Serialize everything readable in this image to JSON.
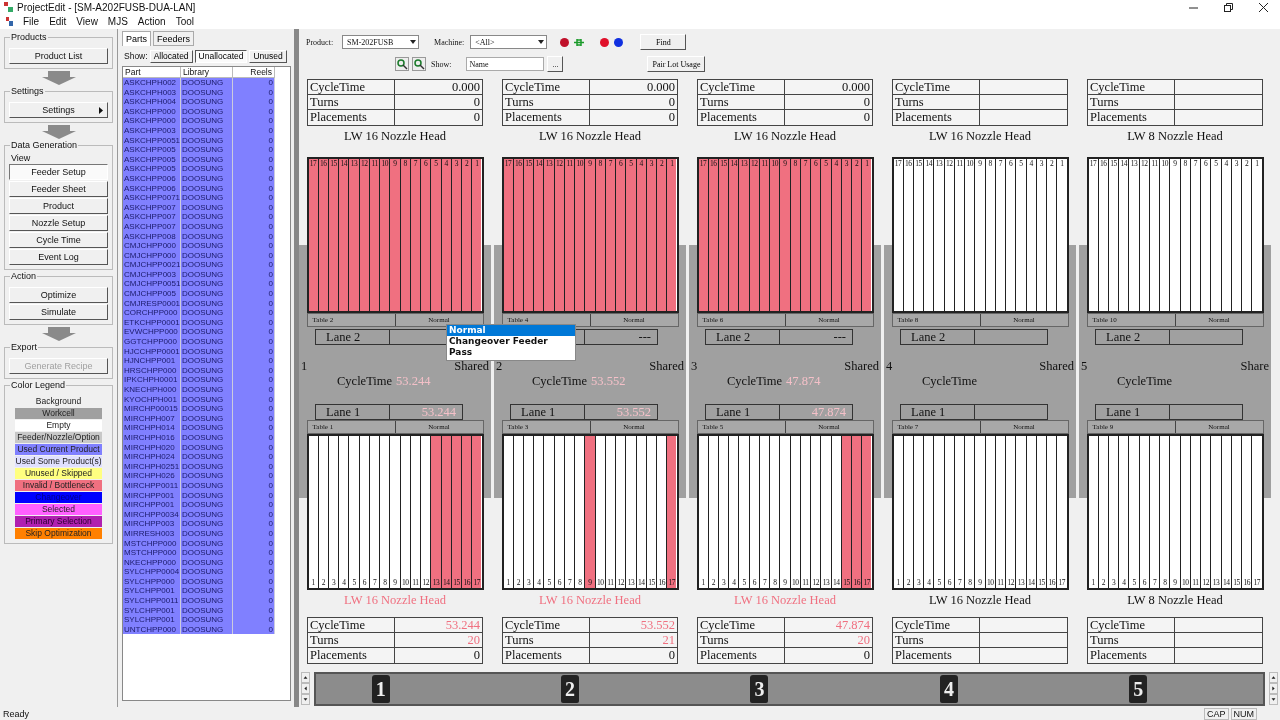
{
  "window": {
    "title": "ProjectEdit - [SM-A202FUSB-DUA-LAN]"
  },
  "menu": [
    "File",
    "Edit",
    "View",
    "MJS",
    "Action",
    "Tool"
  ],
  "sidebar": {
    "groups": [
      {
        "title": "Products",
        "arrow_after": true,
        "buttons": [
          {
            "label": "Product List",
            "kind": "plain",
            "selected": false,
            "disabled": false
          }
        ]
      },
      {
        "title": "Settings",
        "arrow_after": true,
        "buttons": [
          {
            "label": "Settings",
            "kind": "submenu",
            "selected": false,
            "disabled": false
          }
        ]
      },
      {
        "title": "Data Generation",
        "subtitle": "View",
        "arrow_after": false,
        "buttons": [
          {
            "label": "Feeder Setup",
            "kind": "plain",
            "selected": true,
            "disabled": false
          },
          {
            "label": "Feeder Sheet",
            "kind": "plain",
            "selected": false,
            "disabled": false
          },
          {
            "label": "Product",
            "kind": "plain",
            "selected": false,
            "disabled": false
          },
          {
            "label": "Nozzle Setup",
            "kind": "plain",
            "selected": false,
            "disabled": false
          },
          {
            "label": "Cycle Time",
            "kind": "plain",
            "selected": false,
            "disabled": false
          },
          {
            "label": "Event Log",
            "kind": "plain",
            "selected": false,
            "disabled": false
          }
        ]
      },
      {
        "title": "Action",
        "arrow_after": true,
        "buttons": [
          {
            "label": "Optimize",
            "kind": "plain",
            "selected": false,
            "disabled": false
          },
          {
            "label": "Simulate",
            "kind": "plain",
            "selected": false,
            "disabled": false
          }
        ]
      },
      {
        "title": "Export",
        "arrow_after": false,
        "buttons": [
          {
            "label": "Generate Recipe",
            "kind": "plain",
            "selected": false,
            "disabled": true
          }
        ]
      }
    ],
    "legend": {
      "title": "Color Legend",
      "items": [
        {
          "label": "Background",
          "color": "#f0f0f0"
        },
        {
          "label": "Workcell",
          "color": "#a0a0a0"
        },
        {
          "label": "Empty",
          "color": "#ffffff"
        },
        {
          "label": "Feeder/Nozzle/Option",
          "color": "#c8c8c8"
        },
        {
          "label": "Used Current Product",
          "color": "#8080ff"
        },
        {
          "label": "Used Some Product(s)",
          "color": "#e0e0ff"
        },
        {
          "label": "Unused / Skipped",
          "color": "#ffff80"
        },
        {
          "label": "Invalid / Bottleneck",
          "color": "#f07080"
        },
        {
          "label": "Changeover",
          "color": "#0000ff"
        },
        {
          "label": "Selected",
          "color": "#ff60ff"
        },
        {
          "label": "Primary Selection",
          "color": "#b020b0"
        },
        {
          "label": "Skip Optimization",
          "color": "#ff8000"
        }
      ]
    }
  },
  "parts": {
    "tabs": [
      {
        "label": "Parts",
        "selected": true
      },
      {
        "label": "Feeders",
        "selected": false
      }
    ],
    "show_label": "Show:",
    "filters": [
      {
        "label": "Allocated",
        "selected": false
      },
      {
        "label": "Unallocated",
        "selected": true
      },
      {
        "label": "Unused",
        "selected": false
      }
    ],
    "columns": [
      "Part",
      "Library",
      "Reels"
    ],
    "rows": [
      {
        "part": "ASKCHPH002",
        "library": "DOOSUNG",
        "reels": "0"
      },
      {
        "part": "ASKCHPH003",
        "library": "DOOSUNG",
        "reels": "0"
      },
      {
        "part": "ASKCHPH004",
        "library": "DOOSUNG",
        "reels": "0"
      },
      {
        "part": "ASKCHPP000",
        "library": "DOOSUNG",
        "reels": "0"
      },
      {
        "part": "ASKCHPP000",
        "library": "DOOSUNG",
        "reels": "0"
      },
      {
        "part": "ASKCHPP003",
        "library": "DOOSUNG",
        "reels": "0"
      },
      {
        "part": "ASKCHPP0051",
        "library": "DOOSUNG",
        "reels": "0"
      },
      {
        "part": "ASKCHPP005",
        "library": "DOOSUNG",
        "reels": "0"
      },
      {
        "part": "ASKCHPP005",
        "library": "DOOSUNG",
        "reels": "0"
      },
      {
        "part": "ASKCHPP005",
        "library": "DOOSUNG",
        "reels": "0"
      },
      {
        "part": "ASKCHPP006",
        "library": "DOOSUNG",
        "reels": "0"
      },
      {
        "part": "ASKCHPP006",
        "library": "DOOSUNG",
        "reels": "0"
      },
      {
        "part": "ASKCHPP0071",
        "library": "DOOSUNG",
        "reels": "0"
      },
      {
        "part": "ASKCHPP007",
        "library": "DOOSUNG",
        "reels": "0"
      },
      {
        "part": "ASKCHPP007",
        "library": "DOOSUNG",
        "reels": "0"
      },
      {
        "part": "ASKCHPP007",
        "library": "DOOSUNG",
        "reels": "0"
      },
      {
        "part": "ASKCHPP008",
        "library": "DOOSUNG",
        "reels": "0"
      },
      {
        "part": "CMJCHPP000",
        "library": "DOOSUNG",
        "reels": "0"
      },
      {
        "part": "CMJCHPP000",
        "library": "DOOSUNG",
        "reels": "0"
      },
      {
        "part": "CMJCHPP0021",
        "library": "DOOSUNG",
        "reels": "0"
      },
      {
        "part": "CMJCHPP003",
        "library": "DOOSUNG",
        "reels": "0"
      },
      {
        "part": "CMJCHPP0051",
        "library": "DOOSUNG",
        "reels": "0"
      },
      {
        "part": "CMJCHPP005",
        "library": "DOOSUNG",
        "reels": "0"
      },
      {
        "part": "CMJRESP0001",
        "library": "DOOSUNG",
        "reels": "0"
      },
      {
        "part": "CORCHPP000",
        "library": "DOOSUNG",
        "reels": "0"
      },
      {
        "part": "ETKCHPP0001",
        "library": "DOOSUNG",
        "reels": "0"
      },
      {
        "part": "EVWCHPP000",
        "library": "DOOSUNG",
        "reels": "0"
      },
      {
        "part": "GGTCHPP000",
        "library": "DOOSUNG",
        "reels": "0"
      },
      {
        "part": "HJCCHPP0001",
        "library": "DOOSUNG",
        "reels": "0"
      },
      {
        "part": "HJNCHPP001",
        "library": "DOOSUNG",
        "reels": "0"
      },
      {
        "part": "HRSCHPP000",
        "library": "DOOSUNG",
        "reels": "0"
      },
      {
        "part": "IPKCHPH0001",
        "library": "DOOSUNG",
        "reels": "0"
      },
      {
        "part": "KNECHPH000",
        "library": "DOOSUNG",
        "reels": "0"
      },
      {
        "part": "KYOCHPH001",
        "library": "DOOSUNG",
        "reels": "0"
      },
      {
        "part": "MIRCHP00015",
        "library": "DOOSUNG",
        "reels": "0"
      },
      {
        "part": "MIRCHPH007",
        "library": "DOOSUNG",
        "reels": "0"
      },
      {
        "part": "MIRCHPH014",
        "library": "DOOSUNG",
        "reels": "0"
      },
      {
        "part": "MIRCHPH016",
        "library": "DOOSUNG",
        "reels": "0"
      },
      {
        "part": "MIRCHPH020",
        "library": "DOOSUNG",
        "reels": "0"
      },
      {
        "part": "MIRCHPH024",
        "library": "DOOSUNG",
        "reels": "0"
      },
      {
        "part": "MIRCHPH0251",
        "library": "DOOSUNG",
        "reels": "0"
      },
      {
        "part": "MIRCHPH026",
        "library": "DOOSUNG",
        "reels": "0"
      },
      {
        "part": "MIRCHPP0011",
        "library": "DOOSUNG",
        "reels": "0"
      },
      {
        "part": "MIRCHPP001",
        "library": "DOOSUNG",
        "reels": "0"
      },
      {
        "part": "MIRCHPP001",
        "library": "DOOSUNG",
        "reels": "0"
      },
      {
        "part": "MIRCHPP0034",
        "library": "DOOSUNG",
        "reels": "0"
      },
      {
        "part": "MIRCHPP003",
        "library": "DOOSUNG",
        "reels": "0"
      },
      {
        "part": "MIRRESH003",
        "library": "DOOSUNG",
        "reels": "0"
      },
      {
        "part": "MSTCHPP000",
        "library": "DOOSUNG",
        "reels": "0"
      },
      {
        "part": "MSTCHPP000",
        "library": "DOOSUNG",
        "reels": "0"
      },
      {
        "part": "NKECHPP000",
        "library": "DOOSUNG",
        "reels": "0"
      },
      {
        "part": "SYLCHPP0004",
        "library": "DOOSUNG",
        "reels": "0"
      },
      {
        "part": "SYLCHPP000",
        "library": "DOOSUNG",
        "reels": "0"
      },
      {
        "part": "SYLCHPP001",
        "library": "DOOSUNG",
        "reels": "0"
      },
      {
        "part": "SYLCHPP0011",
        "library": "DOOSUNG",
        "reels": "0"
      },
      {
        "part": "SYLCHPP001",
        "library": "DOOSUNG",
        "reels": "0"
      },
      {
        "part": "SYLCHPP001",
        "library": "DOOSUNG",
        "reels": "0"
      },
      {
        "part": "UNTCHPP000",
        "library": "DOOSUNG",
        "reels": "0"
      }
    ]
  },
  "toolbar": {
    "product_label": "Product:",
    "product": "SM-202FUSB",
    "machine_label": "Machine:",
    "machine": "<All>",
    "find": "Find",
    "show_label": "Show:",
    "show": "Name",
    "browse": "...",
    "pair_lot": "Pair Lot Usage"
  },
  "popup_menu": {
    "items": [
      {
        "label": "Normal",
        "selected": true
      },
      {
        "label": "Changeover Feeder",
        "selected": false
      },
      {
        "label": "Pass",
        "selected": false
      }
    ]
  },
  "machines": [
    {
      "number": "1",
      "shared": "Shared",
      "top_stats": [
        {
          "label": "CycleTime",
          "value": "0.000"
        },
        {
          "label": "Turns",
          "value": "0"
        },
        {
          "label": "Placements",
          "value": "0"
        }
      ],
      "top_head": {
        "label": "LW 16 Nozzle Head",
        "invalid": false
      },
      "rear_table": {
        "name": "Table 2",
        "mode": "Normal",
        "slots": [
          {
            "n": "17",
            "used": true
          },
          {
            "n": "16",
            "used": true
          },
          {
            "n": "15",
            "used": true
          },
          {
            "n": "14",
            "used": true
          },
          {
            "n": "13",
            "used": true
          },
          {
            "n": "12",
            "used": true
          },
          {
            "n": "11",
            "used": true
          },
          {
            "n": "10",
            "used": true
          },
          {
            "n": "9",
            "used": true
          },
          {
            "n": "8",
            "used": true
          },
          {
            "n": "7",
            "used": true
          },
          {
            "n": "6",
            "used": true
          },
          {
            "n": "5",
            "used": true
          },
          {
            "n": "4",
            "used": true
          },
          {
            "n": "3",
            "used": true
          },
          {
            "n": "2",
            "used": true
          },
          {
            "n": "1",
            "used": true
          }
        ]
      },
      "rear_lane": {
        "label": "Lane 2"
      },
      "cycle": {
        "label": "CycleTime",
        "value": "53.244"
      },
      "front_lane": {
        "label": "Lane 1",
        "value": "53.244"
      },
      "front_table": {
        "name": "Table 1",
        "mode": "Normal",
        "slots": [
          {
            "n": "1",
            "used": false
          },
          {
            "n": "2",
            "used": false
          },
          {
            "n": "3",
            "used": false
          },
          {
            "n": "4",
            "used": false
          },
          {
            "n": "5",
            "used": false
          },
          {
            "n": "6",
            "used": false
          },
          {
            "n": "7",
            "used": false
          },
          {
            "n": "8",
            "used": false
          },
          {
            "n": "9",
            "used": false
          },
          {
            "n": "10",
            "used": false
          },
          {
            "n": "11",
            "used": false
          },
          {
            "n": "12",
            "used": false
          },
          {
            "n": "13",
            "used": true
          },
          {
            "n": "14",
            "used": true
          },
          {
            "n": "15",
            "used": true
          },
          {
            "n": "16",
            "used": true
          },
          {
            "n": "17",
            "used": true
          }
        ]
      },
      "bottom_head": {
        "label": "LW 16 Nozzle Head",
        "invalid": true
      },
      "bottom_stats": [
        {
          "label": "CycleTime",
          "value": "53.244",
          "invalid": true
        },
        {
          "label": "Turns",
          "value": "20",
          "invalid": true
        },
        {
          "label": "Placements",
          "value": "0",
          "invalid": false
        }
      ]
    },
    {
      "number": "2",
      "shared": "Shared",
      "top_stats": [
        {
          "label": "CycleTime",
          "value": "0.000"
        },
        {
          "label": "Turns",
          "value": "0"
        },
        {
          "label": "Placements",
          "value": "0"
        }
      ],
      "top_head": {
        "label": "LW 16 Nozzle Head",
        "invalid": false
      },
      "rear_table": {
        "name": "Table 4",
        "mode": "Normal",
        "slots": [
          {
            "n": "17",
            "used": true
          },
          {
            "n": "16",
            "used": true
          },
          {
            "n": "15",
            "used": true
          },
          {
            "n": "14",
            "used": true
          },
          {
            "n": "13",
            "used": true
          },
          {
            "n": "12",
            "used": true
          },
          {
            "n": "11",
            "used": true
          },
          {
            "n": "10",
            "used": true
          },
          {
            "n": "9",
            "used": true
          },
          {
            "n": "8",
            "used": true
          },
          {
            "n": "7",
            "used": true
          },
          {
            "n": "6",
            "used": true
          },
          {
            "n": "5",
            "used": true
          },
          {
            "n": "4",
            "used": true
          },
          {
            "n": "3",
            "used": true
          },
          {
            "n": "2",
            "used": true
          },
          {
            "n": "1",
            "used": true
          }
        ]
      },
      "rear_lane": {
        "value": "---"
      },
      "cycle": {
        "label": "CycleTime",
        "value": "53.552"
      },
      "front_lane": {
        "label": "Lane 1",
        "value": "53.552"
      },
      "front_table": {
        "name": "Table 3",
        "mode": "Normal",
        "slots": [
          {
            "n": "1",
            "used": false
          },
          {
            "n": "2",
            "used": false
          },
          {
            "n": "3",
            "used": false
          },
          {
            "n": "4",
            "used": false
          },
          {
            "n": "5",
            "used": false
          },
          {
            "n": "6",
            "used": false
          },
          {
            "n": "7",
            "used": false
          },
          {
            "n": "8",
            "used": false
          },
          {
            "n": "9",
            "used": true
          },
          {
            "n": "10",
            "used": false
          },
          {
            "n": "11",
            "used": false
          },
          {
            "n": "12",
            "used": false
          },
          {
            "n": "13",
            "used": false
          },
          {
            "n": "14",
            "used": false
          },
          {
            "n": "15",
            "used": false
          },
          {
            "n": "16",
            "used": false
          },
          {
            "n": "17",
            "used": true
          }
        ]
      },
      "bottom_head": {
        "label": "LW 16 Nozzle Head",
        "invalid": true
      },
      "bottom_stats": [
        {
          "label": "CycleTime",
          "value": "53.552",
          "invalid": true
        },
        {
          "label": "Turns",
          "value": "21",
          "invalid": true
        },
        {
          "label": "Placements",
          "value": "0",
          "invalid": false
        }
      ]
    },
    {
      "number": "3",
      "shared": "Shared",
      "top_stats": [
        {
          "label": "CycleTime",
          "value": "0.000"
        },
        {
          "label": "Turns",
          "value": "0"
        },
        {
          "label": "Placements",
          "value": "0"
        }
      ],
      "top_head": {
        "label": "LW 16 Nozzle Head",
        "invalid": false
      },
      "rear_table": {
        "name": "Table 6",
        "mode": "Normal",
        "slots": [
          {
            "n": "17",
            "used": true
          },
          {
            "n": "16",
            "used": true
          },
          {
            "n": "15",
            "used": true
          },
          {
            "n": "14",
            "used": true
          },
          {
            "n": "13",
            "used": true
          },
          {
            "n": "12",
            "used": true
          },
          {
            "n": "11",
            "used": true
          },
          {
            "n": "10",
            "used": true
          },
          {
            "n": "9",
            "used": true
          },
          {
            "n": "8",
            "used": true
          },
          {
            "n": "7",
            "used": true
          },
          {
            "n": "6",
            "used": true
          },
          {
            "n": "5",
            "used": true
          },
          {
            "n": "4",
            "used": true
          },
          {
            "n": "3",
            "used": true
          },
          {
            "n": "2",
            "used": true
          },
          {
            "n": "1",
            "used": true
          }
        ]
      },
      "rear_lane": {
        "label": "Lane 2",
        "value": "---"
      },
      "cycle": {
        "label": "CycleTime",
        "value": "47.874"
      },
      "front_lane": {
        "label": "Lane 1",
        "value": "47.874"
      },
      "front_table": {
        "name": "Table 5",
        "mode": "Normal",
        "slots": [
          {
            "n": "1",
            "used": false
          },
          {
            "n": "2",
            "used": false
          },
          {
            "n": "3",
            "used": false
          },
          {
            "n": "4",
            "used": false
          },
          {
            "n": "5",
            "used": false
          },
          {
            "n": "6",
            "used": false
          },
          {
            "n": "7",
            "used": false
          },
          {
            "n": "8",
            "used": false
          },
          {
            "n": "9",
            "used": false
          },
          {
            "n": "10",
            "used": false
          },
          {
            "n": "11",
            "used": false
          },
          {
            "n": "12",
            "used": false
          },
          {
            "n": "13",
            "used": false
          },
          {
            "n": "14",
            "used": false
          },
          {
            "n": "15",
            "used": true
          },
          {
            "n": "16",
            "used": true
          },
          {
            "n": "17",
            "used": true
          }
        ]
      },
      "bottom_head": {
        "label": "LW 16 Nozzle Head",
        "invalid": true
      },
      "bottom_stats": [
        {
          "label": "CycleTime",
          "value": "47.874",
          "invalid": true
        },
        {
          "label": "Turns",
          "value": "20",
          "invalid": true
        },
        {
          "label": "Placements",
          "value": "0",
          "invalid": false
        }
      ]
    },
    {
      "number": "4",
      "shared": "Shared",
      "top_stats": [
        {
          "label": "CycleTime"
        },
        {
          "label": "Turns"
        },
        {
          "label": "Placements"
        }
      ],
      "top_head": {
        "label": "LW 16 Nozzle Head",
        "invalid": false
      },
      "rear_table": {
        "name": "Table 8",
        "mode": "Normal",
        "slots": [
          {
            "n": "17",
            "used": false
          },
          {
            "n": "16",
            "used": false
          },
          {
            "n": "15",
            "used": false
          },
          {
            "n": "14",
            "used": false
          },
          {
            "n": "13",
            "used": false
          },
          {
            "n": "12",
            "used": false
          },
          {
            "n": "11",
            "used": false
          },
          {
            "n": "10",
            "used": false
          },
          {
            "n": "9",
            "used": false
          },
          {
            "n": "8",
            "used": false
          },
          {
            "n": "7",
            "used": false
          },
          {
            "n": "6",
            "used": false
          },
          {
            "n": "5",
            "used": false
          },
          {
            "n": "4",
            "used": false
          },
          {
            "n": "3",
            "used": false
          },
          {
            "n": "2",
            "used": false
          },
          {
            "n": "1",
            "used": false
          }
        ]
      },
      "rear_lane": {
        "label": "Lane 2"
      },
      "cycle": {
        "label": "CycleTime"
      },
      "front_lane": {
        "label": "Lane 1"
      },
      "front_table": {
        "name": "Table 7",
        "mode": "Normal",
        "slots": [
          {
            "n": "1",
            "used": false
          },
          {
            "n": "2",
            "used": false
          },
          {
            "n": "3",
            "used": false
          },
          {
            "n": "4",
            "used": false
          },
          {
            "n": "5",
            "used": false
          },
          {
            "n": "6",
            "used": false
          },
          {
            "n": "7",
            "used": false
          },
          {
            "n": "8",
            "used": false
          },
          {
            "n": "9",
            "used": false
          },
          {
            "n": "10",
            "used": false
          },
          {
            "n": "11",
            "used": false
          },
          {
            "n": "12",
            "used": false
          },
          {
            "n": "13",
            "used": false
          },
          {
            "n": "14",
            "used": false
          },
          {
            "n": "15",
            "used": false
          },
          {
            "n": "16",
            "used": false
          },
          {
            "n": "17",
            "used": false
          }
        ]
      },
      "bottom_head": {
        "label": "LW 16 Nozzle Head",
        "invalid": false
      },
      "bottom_stats": [
        {
          "label": "CycleTime"
        },
        {
          "label": "Turns"
        },
        {
          "label": "Placements"
        }
      ]
    },
    {
      "number": "5",
      "shared": "Share",
      "top_stats": [
        {
          "label": "CycleTime"
        },
        {
          "label": "Turns"
        },
        {
          "label": "Placements"
        }
      ],
      "top_head": {
        "label": "LW 8 Nozzle Head",
        "invalid": false
      },
      "rear_table": {
        "name": "Table 10",
        "mode": "Normal",
        "slots": [
          {
            "n": "17",
            "used": false
          },
          {
            "n": "16",
            "used": false
          },
          {
            "n": "15",
            "used": false
          },
          {
            "n": "14",
            "used": false
          },
          {
            "n": "13",
            "used": false
          },
          {
            "n": "12",
            "used": false
          },
          {
            "n": "11",
            "used": false
          },
          {
            "n": "10",
            "used": false
          },
          {
            "n": "9",
            "used": false
          },
          {
            "n": "8",
            "used": false
          },
          {
            "n": "7",
            "used": false
          },
          {
            "n": "6",
            "used": false
          },
          {
            "n": "5",
            "used": false
          },
          {
            "n": "4",
            "used": false
          },
          {
            "n": "3",
            "used": false
          },
          {
            "n": "2",
            "used": false
          },
          {
            "n": "1",
            "used": false
          }
        ]
      },
      "rear_lane": {
        "label": "Lane 2"
      },
      "cycle": {
        "label": "CycleTime"
      },
      "front_lane": {
        "label": "Lane 1"
      },
      "front_table": {
        "name": "Table 9",
        "mode": "Normal",
        "slots": [
          {
            "n": "1",
            "used": false
          },
          {
            "n": "2",
            "used": false
          },
          {
            "n": "3",
            "used": false
          },
          {
            "n": "4",
            "used": false
          },
          {
            "n": "5",
            "used": false
          },
          {
            "n": "6",
            "used": false
          },
          {
            "n": "7",
            "used": false
          },
          {
            "n": "8",
            "used": false
          },
          {
            "n": "9",
            "used": false
          },
          {
            "n": "10",
            "used": false
          },
          {
            "n": "11",
            "used": false
          },
          {
            "n": "12",
            "used": false
          },
          {
            "n": "13",
            "used": false
          },
          {
            "n": "14",
            "used": false
          },
          {
            "n": "15",
            "used": false
          },
          {
            "n": "16",
            "used": false
          },
          {
            "n": "17",
            "used": false
          }
        ]
      },
      "bottom_head": {
        "label": "LW 8 Nozzle Head",
        "invalid": false
      },
      "bottom_stats": [
        {
          "label": "CycleTime"
        },
        {
          "label": "Turns"
        },
        {
          "label": "Placements"
        }
      ]
    }
  ],
  "machine_strip": [
    "1",
    "2",
    "3",
    "4",
    "5"
  ],
  "status_bar": {
    "text": "Ready",
    "indicators": [
      "CAP",
      "NUM"
    ]
  }
}
